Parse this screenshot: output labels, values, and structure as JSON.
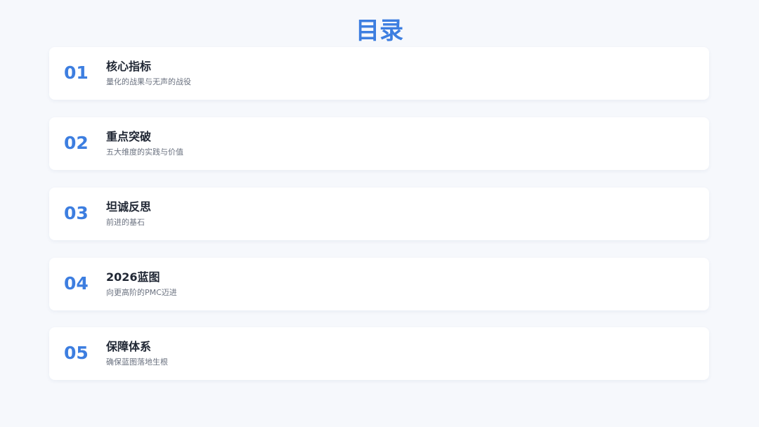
{
  "title": "目录",
  "items": [
    {
      "number": "01",
      "heading": "核心指标",
      "subtitle": "量化的战果与无声的战役"
    },
    {
      "number": "02",
      "heading": "重点突破",
      "subtitle": "五大维度的实践与价值"
    },
    {
      "number": "03",
      "heading": "坦诚反思",
      "subtitle": "前进的基石"
    },
    {
      "number": "04",
      "heading": "2026蓝图",
      "subtitle": "向更高阶的PMC迈进"
    },
    {
      "number": "05",
      "heading": "保障体系",
      "subtitle": "确保蓝图落地生根"
    }
  ],
  "colors": {
    "accent": "#3d7ee0",
    "background": "#f6f8fc",
    "card": "#ffffff",
    "heading_text": "#1f2633",
    "subtitle_text": "#6b7280"
  }
}
